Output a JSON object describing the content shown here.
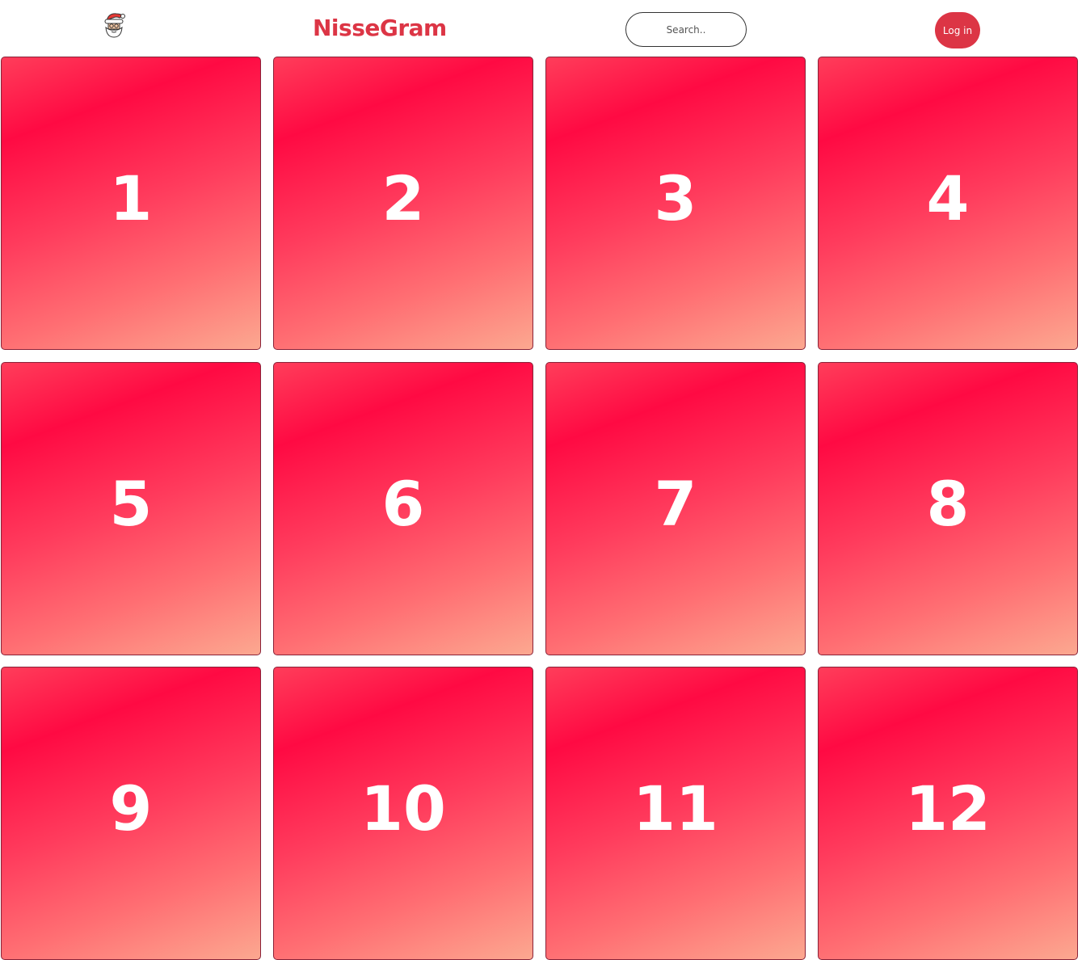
{
  "header": {
    "logo_icon": "santa-icon",
    "brand": "NisseGram",
    "search_placeholder": "Search..",
    "login_label": "Log in",
    "accent_color": "#dc3545"
  },
  "calendar": {
    "doors": [
      {
        "label": "1"
      },
      {
        "label": "2"
      },
      {
        "label": "3"
      },
      {
        "label": "4"
      },
      {
        "label": "5"
      },
      {
        "label": "6"
      },
      {
        "label": "7"
      },
      {
        "label": "8"
      },
      {
        "label": "9"
      },
      {
        "label": "10"
      },
      {
        "label": "11"
      },
      {
        "label": "12"
      }
    ],
    "gradient_colors": [
      "#ff0a43",
      "#fca890"
    ]
  }
}
